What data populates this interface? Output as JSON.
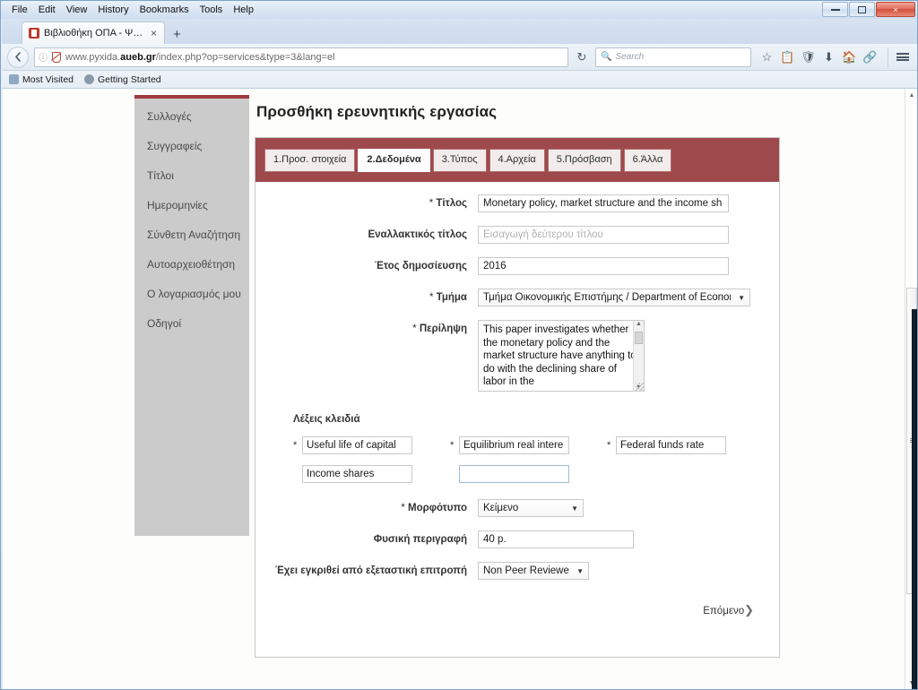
{
  "browser": {
    "menus": [
      "File",
      "Edit",
      "View",
      "History",
      "Bookmarks",
      "Tools",
      "Help"
    ],
    "window_controls": {
      "minimize": "minimize",
      "maximize": "maximize",
      "close": "×"
    },
    "tab": {
      "title": "Βιβλιοθήκη ΟΠΑ - Ψηφιακ...",
      "close": "×"
    },
    "new_tab": "+",
    "url": {
      "prefix": "www.pyxida.",
      "domain": "aueb.gr",
      "path": "/index.php?op=services&type=3&lang=el"
    },
    "reload": "↻",
    "search": {
      "placeholder": "Search",
      "icon": "search-icon"
    },
    "bookmarks": [
      {
        "label": "Most Visited"
      },
      {
        "label": "Getting Started"
      }
    ],
    "toolbar_icons": [
      "bookmark-star-icon",
      "reading-list-icon",
      "pocket-shield-icon",
      "downloads-icon",
      "home-icon",
      "sync-icon",
      "menu-hamburger-icon"
    ]
  },
  "sidebar": {
    "items": [
      {
        "label": "Συλλογές"
      },
      {
        "label": "Συγγραφείς"
      },
      {
        "label": "Τίτλοι"
      },
      {
        "label": "Ημερομηνίες"
      },
      {
        "label": "Σύνθετη Αναζήτηση"
      },
      {
        "label": "Αυτοαρχειοθέτηση"
      },
      {
        "label": "Ο λογαριασμός μου"
      },
      {
        "label": "Οδηγοί"
      }
    ]
  },
  "page": {
    "heading": "Προσθήκη ερευνητικής εργασίας",
    "accent_color": "#9e4a4d",
    "tabs": [
      {
        "label": "1.Προσ. στοιχεία",
        "active": false
      },
      {
        "label": "2.Δεδομένα",
        "active": true
      },
      {
        "label": "3.Τύπος",
        "active": false
      },
      {
        "label": "4.Αρχεία",
        "active": false
      },
      {
        "label": "5.Πρόσβαση",
        "active": false
      },
      {
        "label": "6.Άλλα",
        "active": false
      }
    ]
  },
  "form": {
    "title": {
      "label": "Τίτλος",
      "required_marker": "*",
      "value": "Monetary policy, market structure and the income sh"
    },
    "alt_title": {
      "label": "Εναλλακτικός τίτλος",
      "required_marker": "",
      "value": "",
      "placeholder": "Εισαγωγή δεύτερου τίτλου"
    },
    "year": {
      "label": "Έτος δημοσίευσης",
      "required_marker": "",
      "value": "2016"
    },
    "department": {
      "label": "Τμήμα",
      "required_marker": "*",
      "value": "Τμήμα Οικονομικής Επιστήμης / Department of Economi"
    },
    "abstract": {
      "label": "Περίληψη",
      "required_marker": "*",
      "value": "This paper investigates whether the monetary policy and the market structure have anything to do with the declining share of labor in the"
    },
    "keywords": {
      "title": "Λέξεις κλειδιά",
      "items": [
        {
          "value": "Useful life of capital",
          "required_marker": "*",
          "focused": false
        },
        {
          "value": "Equilibrium real intere",
          "required_marker": "*",
          "focused": false
        },
        {
          "value": "Federal funds rate",
          "required_marker": "*",
          "focused": false
        },
        {
          "value": "Income shares",
          "required_marker": "",
          "focused": false
        },
        {
          "value": "",
          "required_marker": "",
          "focused": true
        }
      ]
    },
    "format": {
      "label": "Μορφότυπο",
      "required_marker": "*",
      "value": "Κείμενο"
    },
    "physical_description": {
      "label": "Φυσική περιγραφή",
      "required_marker": "",
      "value": "40 p."
    },
    "peer_reviewed": {
      "label": "Έχει εγκριθεί από εξεταστική επιτροπή",
      "required_marker": "",
      "value": "Non Peer Reviewed"
    },
    "next_button": {
      "label": "Επόμενο",
      "chevron": "❯"
    }
  }
}
